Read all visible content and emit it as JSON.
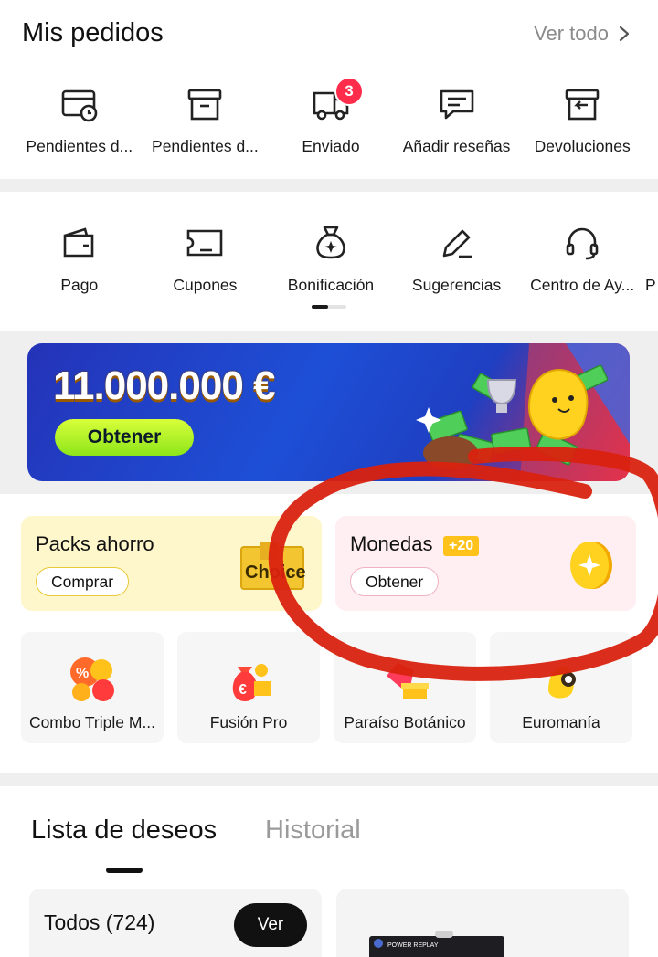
{
  "orders": {
    "title": "Mis pedidos",
    "see_all": "Ver todo",
    "items": [
      {
        "label": "Pendientes d...",
        "icon": "pending-payment-icon"
      },
      {
        "label": "Pendientes d...",
        "icon": "pending-shipment-icon"
      },
      {
        "label": "Enviado",
        "icon": "shipped-truck-icon",
        "badge": "3"
      },
      {
        "label": "Añadir reseñas",
        "icon": "review-icon"
      },
      {
        "label": "Devoluciones",
        "icon": "returns-icon"
      }
    ]
  },
  "services": {
    "items": [
      {
        "label": "Pago",
        "icon": "wallet-icon"
      },
      {
        "label": "Cupones",
        "icon": "coupon-icon"
      },
      {
        "label": "Bonificación",
        "icon": "bonus-bag-icon"
      },
      {
        "label": "Sugerencias",
        "icon": "edit-pencil-icon"
      },
      {
        "label": "Centro de Ay...",
        "icon": "headset-icon"
      },
      {
        "label": "P",
        "icon": ""
      }
    ]
  },
  "banner": {
    "amount": "11.000.000 €",
    "button": "Obtener"
  },
  "cards": {
    "packs": {
      "title": "Packs ahorro",
      "button": "Comprar",
      "art_text": "Choice",
      "color": "#fff7cc"
    },
    "coins": {
      "title": "Monedas",
      "bonus": "+20",
      "button": "Obtener",
      "color": "#ffeef2"
    }
  },
  "tiles": [
    {
      "label": "Combo Triple M...",
      "icon": "combo-discount-icon"
    },
    {
      "label": "Fusión Pro",
      "icon": "money-bag-icon"
    },
    {
      "label": "Paraíso Botánico",
      "icon": "shopping-bag-icon"
    },
    {
      "label": "Euromanía",
      "icon": "mascot-icon"
    }
  ],
  "wishlist": {
    "tabs": [
      "Lista de deseos",
      "Historial"
    ],
    "count_label": "Todos (724)",
    "view_button": "Ver",
    "product_brand": "POWER REPLAY"
  },
  "colors": {
    "accent_badge": "#ff2d4b",
    "annotation_red": "#d9220f",
    "banner_button": "#b4f22a"
  }
}
